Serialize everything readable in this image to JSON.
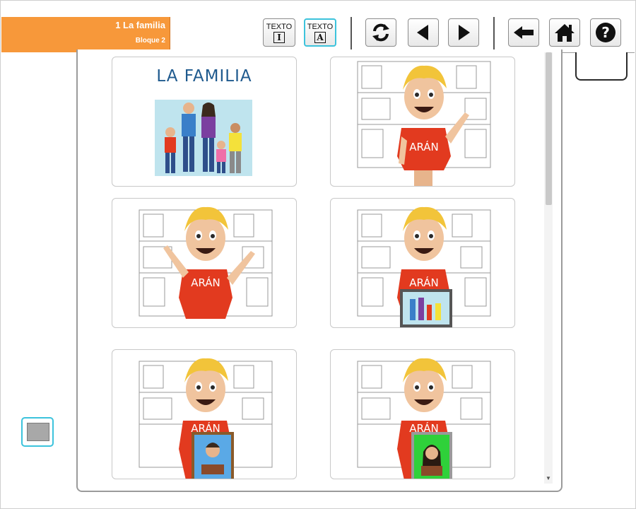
{
  "header": {
    "title": "1 La familia",
    "subtitle": "Bloque 2",
    "texto_upper_label": "TEXTO",
    "texto_upper_glyph": "I",
    "texto_caps_label": "TEXTO",
    "texto_caps_glyph": "A"
  },
  "toolbar": {
    "icons": [
      "refresh-icon",
      "previous-icon",
      "next-icon",
      "back-arrow-icon",
      "home-icon",
      "help-icon"
    ]
  },
  "cards": [
    {
      "title": "LA FAMILIA"
    },
    {
      "shirt": "ARÁN"
    },
    {
      "shirt": "ARÁN"
    },
    {
      "shirt": "ARÁN"
    },
    {
      "shirt": "ARÁN"
    },
    {
      "shirt": "ARÁN"
    }
  ],
  "colors": {
    "title_bar": "#f7983a",
    "accent": "#3cc3dc",
    "shirt": "#e23a1f",
    "hair": "#f2c43a"
  }
}
